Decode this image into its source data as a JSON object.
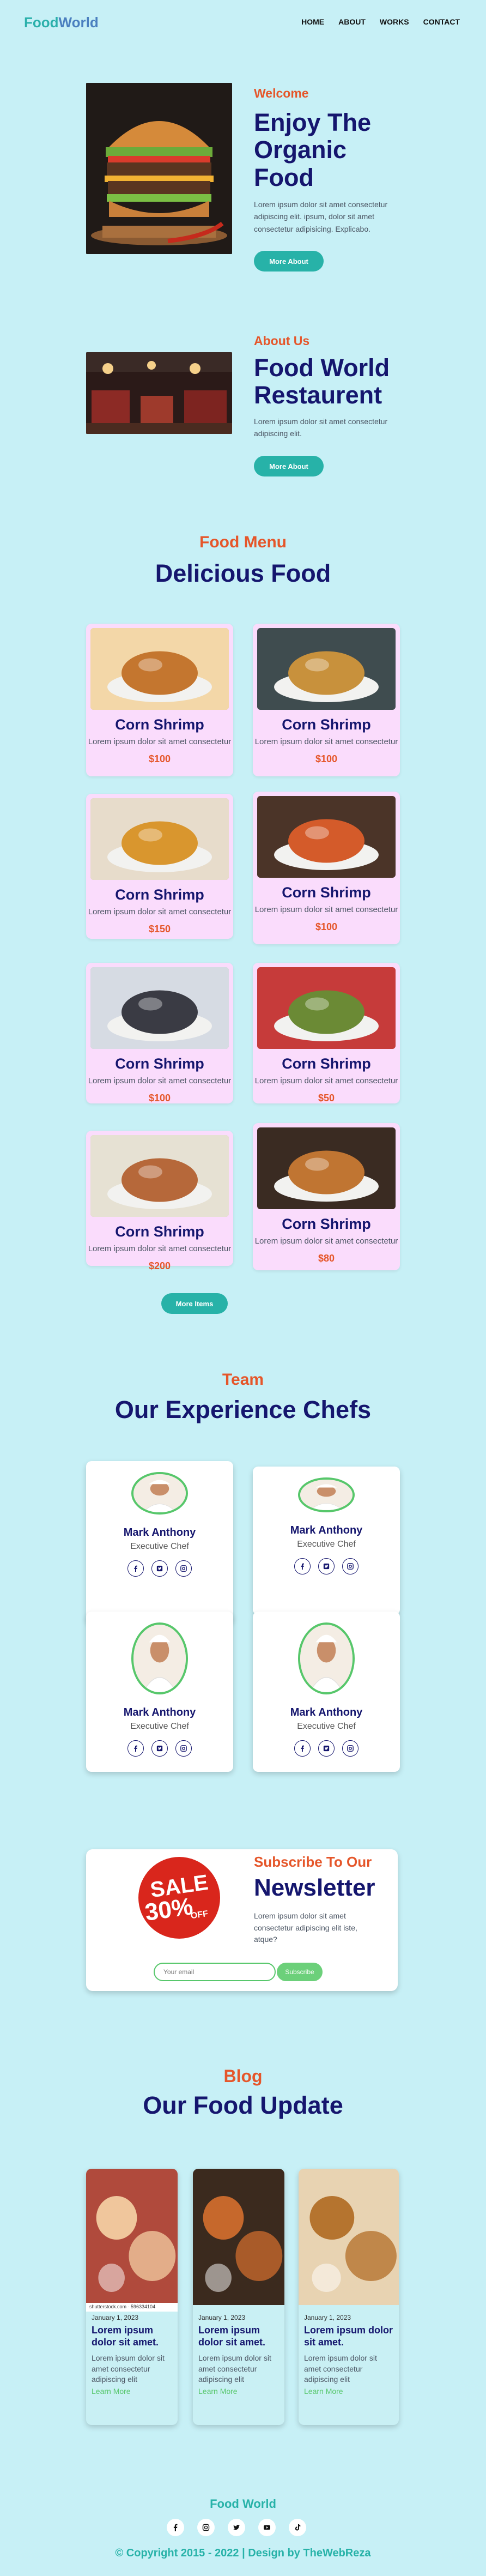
{
  "nav": {
    "logo_part1": "Food",
    "logo_part2": "World",
    "links": [
      "HOME",
      "ABOUT",
      "WORKS",
      "CONTACT"
    ]
  },
  "hero": {
    "kicker": "Welcome",
    "title": "Enjoy The Organic Food",
    "text": "Lorem ipsum dolor sit amet consectetur adipiscing elit. ipsum, dolor sit amet consectetur adipisicing. Explicabo.",
    "button": "More About"
  },
  "about": {
    "kicker": "About Us",
    "title": "Food World Restaurent",
    "text": "Lorem ipsum dolor sit amet consectetur adipiscing elit.",
    "button": "More About"
  },
  "menu": {
    "kicker": "Food Menu",
    "title": "Delicious Food",
    "button": "More Items",
    "items": [
      {
        "name": "Corn Shrimp",
        "desc": "Lorem ipsum dolor sit amet consectetur",
        "price": "$100"
      },
      {
        "name": "Corn Shrimp",
        "desc": "Lorem ipsum dolor sit amet consectetur",
        "price": "$100"
      },
      {
        "name": "Corn Shrimp",
        "desc": "Lorem ipsum dolor sit amet consectetur",
        "price": "$150"
      },
      {
        "name": "Corn Shrimp",
        "desc": "Lorem ipsum dolor sit amet consectetur",
        "price": "$100"
      },
      {
        "name": "Corn Shrimp",
        "desc": "Lorem ipsum dolor sit amet consectetur",
        "price": "$100"
      },
      {
        "name": "Corn Shrimp",
        "desc": "Lorem ipsum dolor sit amet consectetur",
        "price": "$50"
      },
      {
        "name": "Corn Shrimp",
        "desc": "Lorem ipsum dolor sit amet consectetur",
        "price": "$200"
      },
      {
        "name": "Corn Shrimp",
        "desc": "Lorem ipsum dolor sit amet consectetur",
        "price": "$80"
      }
    ]
  },
  "team": {
    "kicker": "Team",
    "title": "Our Experience Chefs",
    "chefs": [
      {
        "name": "Mark Anthony",
        "role": "Executive Chef"
      },
      {
        "name": "Mark Anthony",
        "role": "Executive Chef"
      },
      {
        "name": "Mark Anthony",
        "role": "Executive Chef"
      },
      {
        "name": "Mark Anthony",
        "role": "Executive Chef"
      }
    ]
  },
  "newsletter": {
    "kicker": "Subscribe To Our",
    "title": "Newsletter",
    "text": "Lorem ipsum dolor sit amet consectetur adipiscing elit iste, atque?",
    "placeholder": "Your email",
    "button": "Subscribe",
    "sale_word": "SALE",
    "sale_percent": "30%",
    "sale_off": "OFF"
  },
  "blog": {
    "kicker": "Blog",
    "title": "Our Food Update",
    "posts": [
      {
        "date": "January 1, 2023",
        "title": "Lorem ipsum dolor sit amet.",
        "desc": "Lorem ipsum dolor sit amet consectetur adipiscing elit",
        "link": "Learn More",
        "credit": "shutterstock.com · 596334104"
      },
      {
        "date": "January 1, 2023",
        "title": "Lorem ipsum dolor sit amet.",
        "desc": "Lorem ipsum dolor sit amet consectetur adipiscing elit",
        "link": "Learn More"
      },
      {
        "date": "January 1, 2023",
        "title": "Lorem ipsum dolor sit amet.",
        "desc": "Lorem ipsum dolor sit amet consectetur adipiscing elit",
        "link": "Learn More"
      }
    ]
  },
  "footer": {
    "title": "Food World",
    "copyright": "© Copyright 2015 - 2022 | Design by TheWebReza",
    "social_icons": [
      "facebook-icon",
      "instagram-icon",
      "twitter-icon",
      "youtube-icon",
      "tiktok-icon"
    ]
  },
  "colors": {
    "bg": "#c7f0f6",
    "accent": "#27b2a8",
    "orange": "#e5562a",
    "navy": "#15166e",
    "pink": "#fadcfc",
    "green": "#57c76b"
  }
}
